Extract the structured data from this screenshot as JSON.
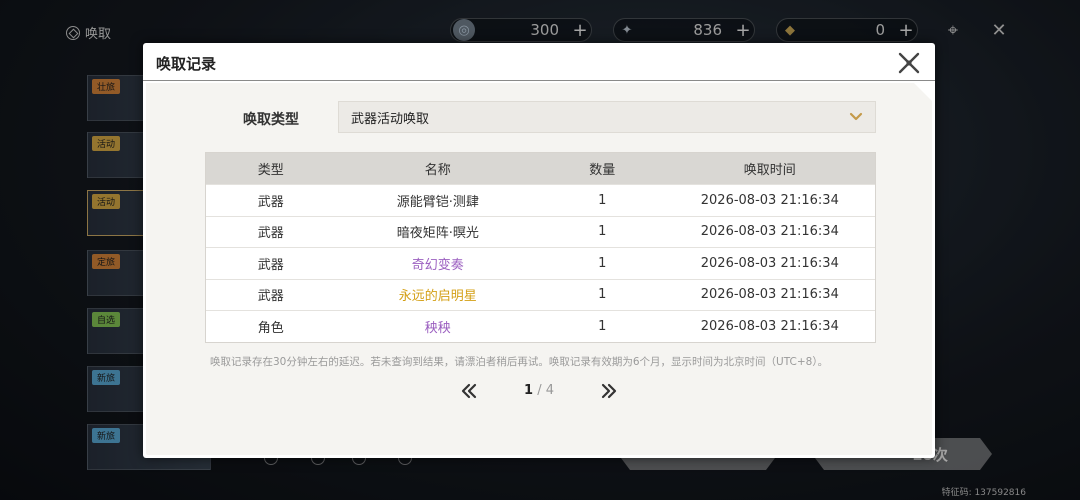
{
  "background": {
    "title": "唤取",
    "currencies": [
      {
        "icon": "lustrous-tide-icon",
        "value": "300"
      },
      {
        "icon": "astrite-icon",
        "value": "836"
      },
      {
        "icon": "radiant-tide-icon",
        "value": "0"
      }
    ],
    "side_tabs": [
      "壮旅",
      "活动",
      "活动",
      "定旅",
      "自选",
      "新旅",
      "新旅"
    ],
    "pull_10_label": "10次",
    "feature_code": "特征码: 137592816"
  },
  "modal": {
    "title": "唤取记录",
    "type_label": "唤取类型",
    "type_value": "武器活动唤取",
    "columns": [
      "类型",
      "名称",
      "数量",
      "唤取时间"
    ],
    "rows": [
      {
        "type": "武器",
        "name": "源能臂铠·测肆",
        "qty": "1",
        "time": "2026-08-03 21:16:34",
        "rarity_color": "#333333"
      },
      {
        "type": "武器",
        "name": "暗夜矩阵·暝光",
        "qty": "1",
        "time": "2026-08-03 21:16:34",
        "rarity_color": "#333333"
      },
      {
        "type": "武器",
        "name": "奇幻变奏",
        "qty": "1",
        "time": "2026-08-03 21:16:34",
        "rarity_color": "#9b5fc0"
      },
      {
        "type": "武器",
        "name": "永远的启明星",
        "qty": "1",
        "time": "2026-08-03 21:16:34",
        "rarity_color": "#d4a017"
      },
      {
        "type": "角色",
        "name": "秧秧",
        "qty": "1",
        "time": "2026-08-03 21:16:34",
        "rarity_color": "#9b5fc0"
      }
    ],
    "note": "唤取记录存在30分钟左右的延迟。若未查询到结果，请漂泊者稍后再试。唤取记录有效期为6个月，显示时间为北京时间（UTC+8）。",
    "pager": {
      "current": "1",
      "separator": "/",
      "total": "4"
    }
  }
}
